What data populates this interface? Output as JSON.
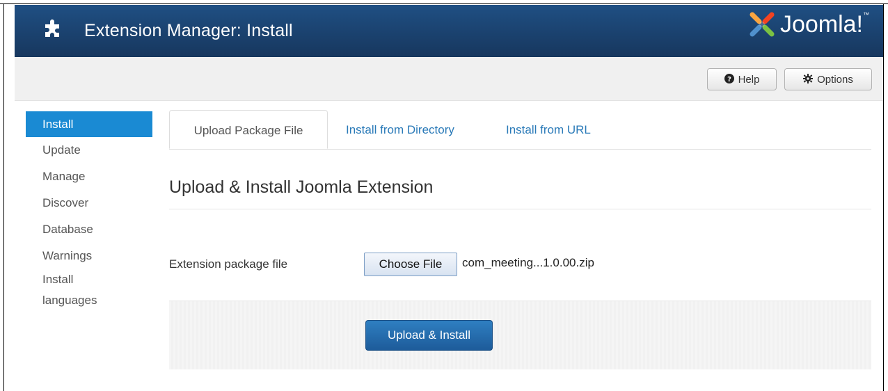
{
  "header": {
    "title": "Extension Manager: Install",
    "logo_text": "Joomla!",
    "logo_mark": "™",
    "bg_color": "#1f4f83"
  },
  "toolbar": {
    "help_label": "Help",
    "help_icon": "question-circle-icon",
    "options_label": "Options",
    "options_icon": "gear-icon"
  },
  "sidebar": {
    "items": [
      {
        "label": "Install",
        "active": true
      },
      {
        "label": "Update"
      },
      {
        "label": "Manage"
      },
      {
        "label": "Discover"
      },
      {
        "label": "Database"
      },
      {
        "label": "Warnings"
      },
      {
        "label": "Install languages"
      }
    ],
    "active_color": "#1a8ad3"
  },
  "tabs": [
    {
      "label": "Upload Package File",
      "active": true
    },
    {
      "label": "Install from Directory"
    },
    {
      "label": "Install from URL"
    }
  ],
  "main": {
    "section_title": "Upload & Install Joomla Extension",
    "field_label": "Extension package file",
    "choose_file_label": "Choose File",
    "file_name": "com_meeting...1.0.00.zip",
    "submit_label": "Upload & Install",
    "link_color": "#2a7ab8"
  }
}
